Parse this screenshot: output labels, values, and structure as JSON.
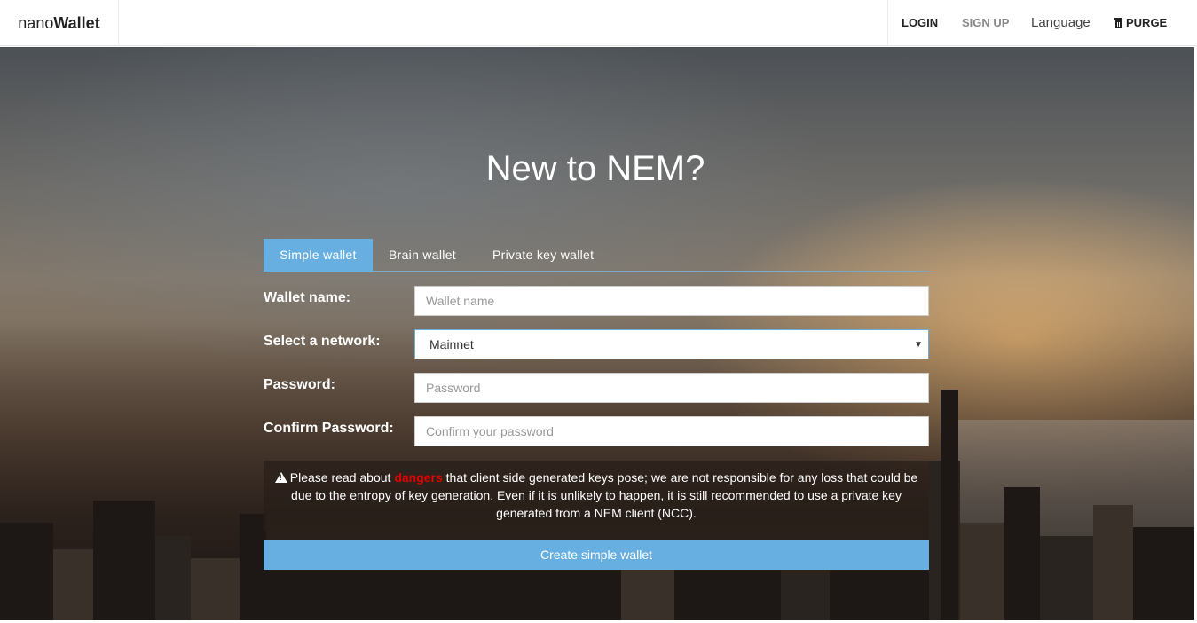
{
  "brand": {
    "prefix": "nano",
    "bold": "Wallet"
  },
  "nav": {
    "login": "LOGIN",
    "signup": "SIGN UP",
    "language": "Language",
    "purge": "PURGE"
  },
  "main": {
    "title": "New to NEM?",
    "tabs": [
      {
        "label": "Simple wallet",
        "active": true
      },
      {
        "label": "Brain wallet",
        "active": false
      },
      {
        "label": "Private key wallet",
        "active": false
      }
    ],
    "form": {
      "wallet_name_label": "Wallet name:",
      "wallet_name_placeholder": "Wallet name",
      "network_label": "Select a network:",
      "network_value": "Mainnet",
      "password_label": "Password:",
      "password_placeholder": "Password",
      "confirm_label": "Confirm Password:",
      "confirm_placeholder": "Confirm your password"
    },
    "warning": {
      "before": "Please read about ",
      "link": "dangers",
      "after": " that client side generated keys pose; we are not responsible for any loss that could be due to the entropy of key generation. Even if it is unlikely to happen, it is still recommended to use a private key generated from a NEM client (NCC)."
    },
    "create_button": "Create simple wallet"
  },
  "colors": {
    "accent": "#66afe0",
    "danger": "#e00000"
  },
  "icons": {
    "purge": "trash-icon",
    "warning": "warning-sign-icon",
    "select": "caret-down-icon"
  }
}
